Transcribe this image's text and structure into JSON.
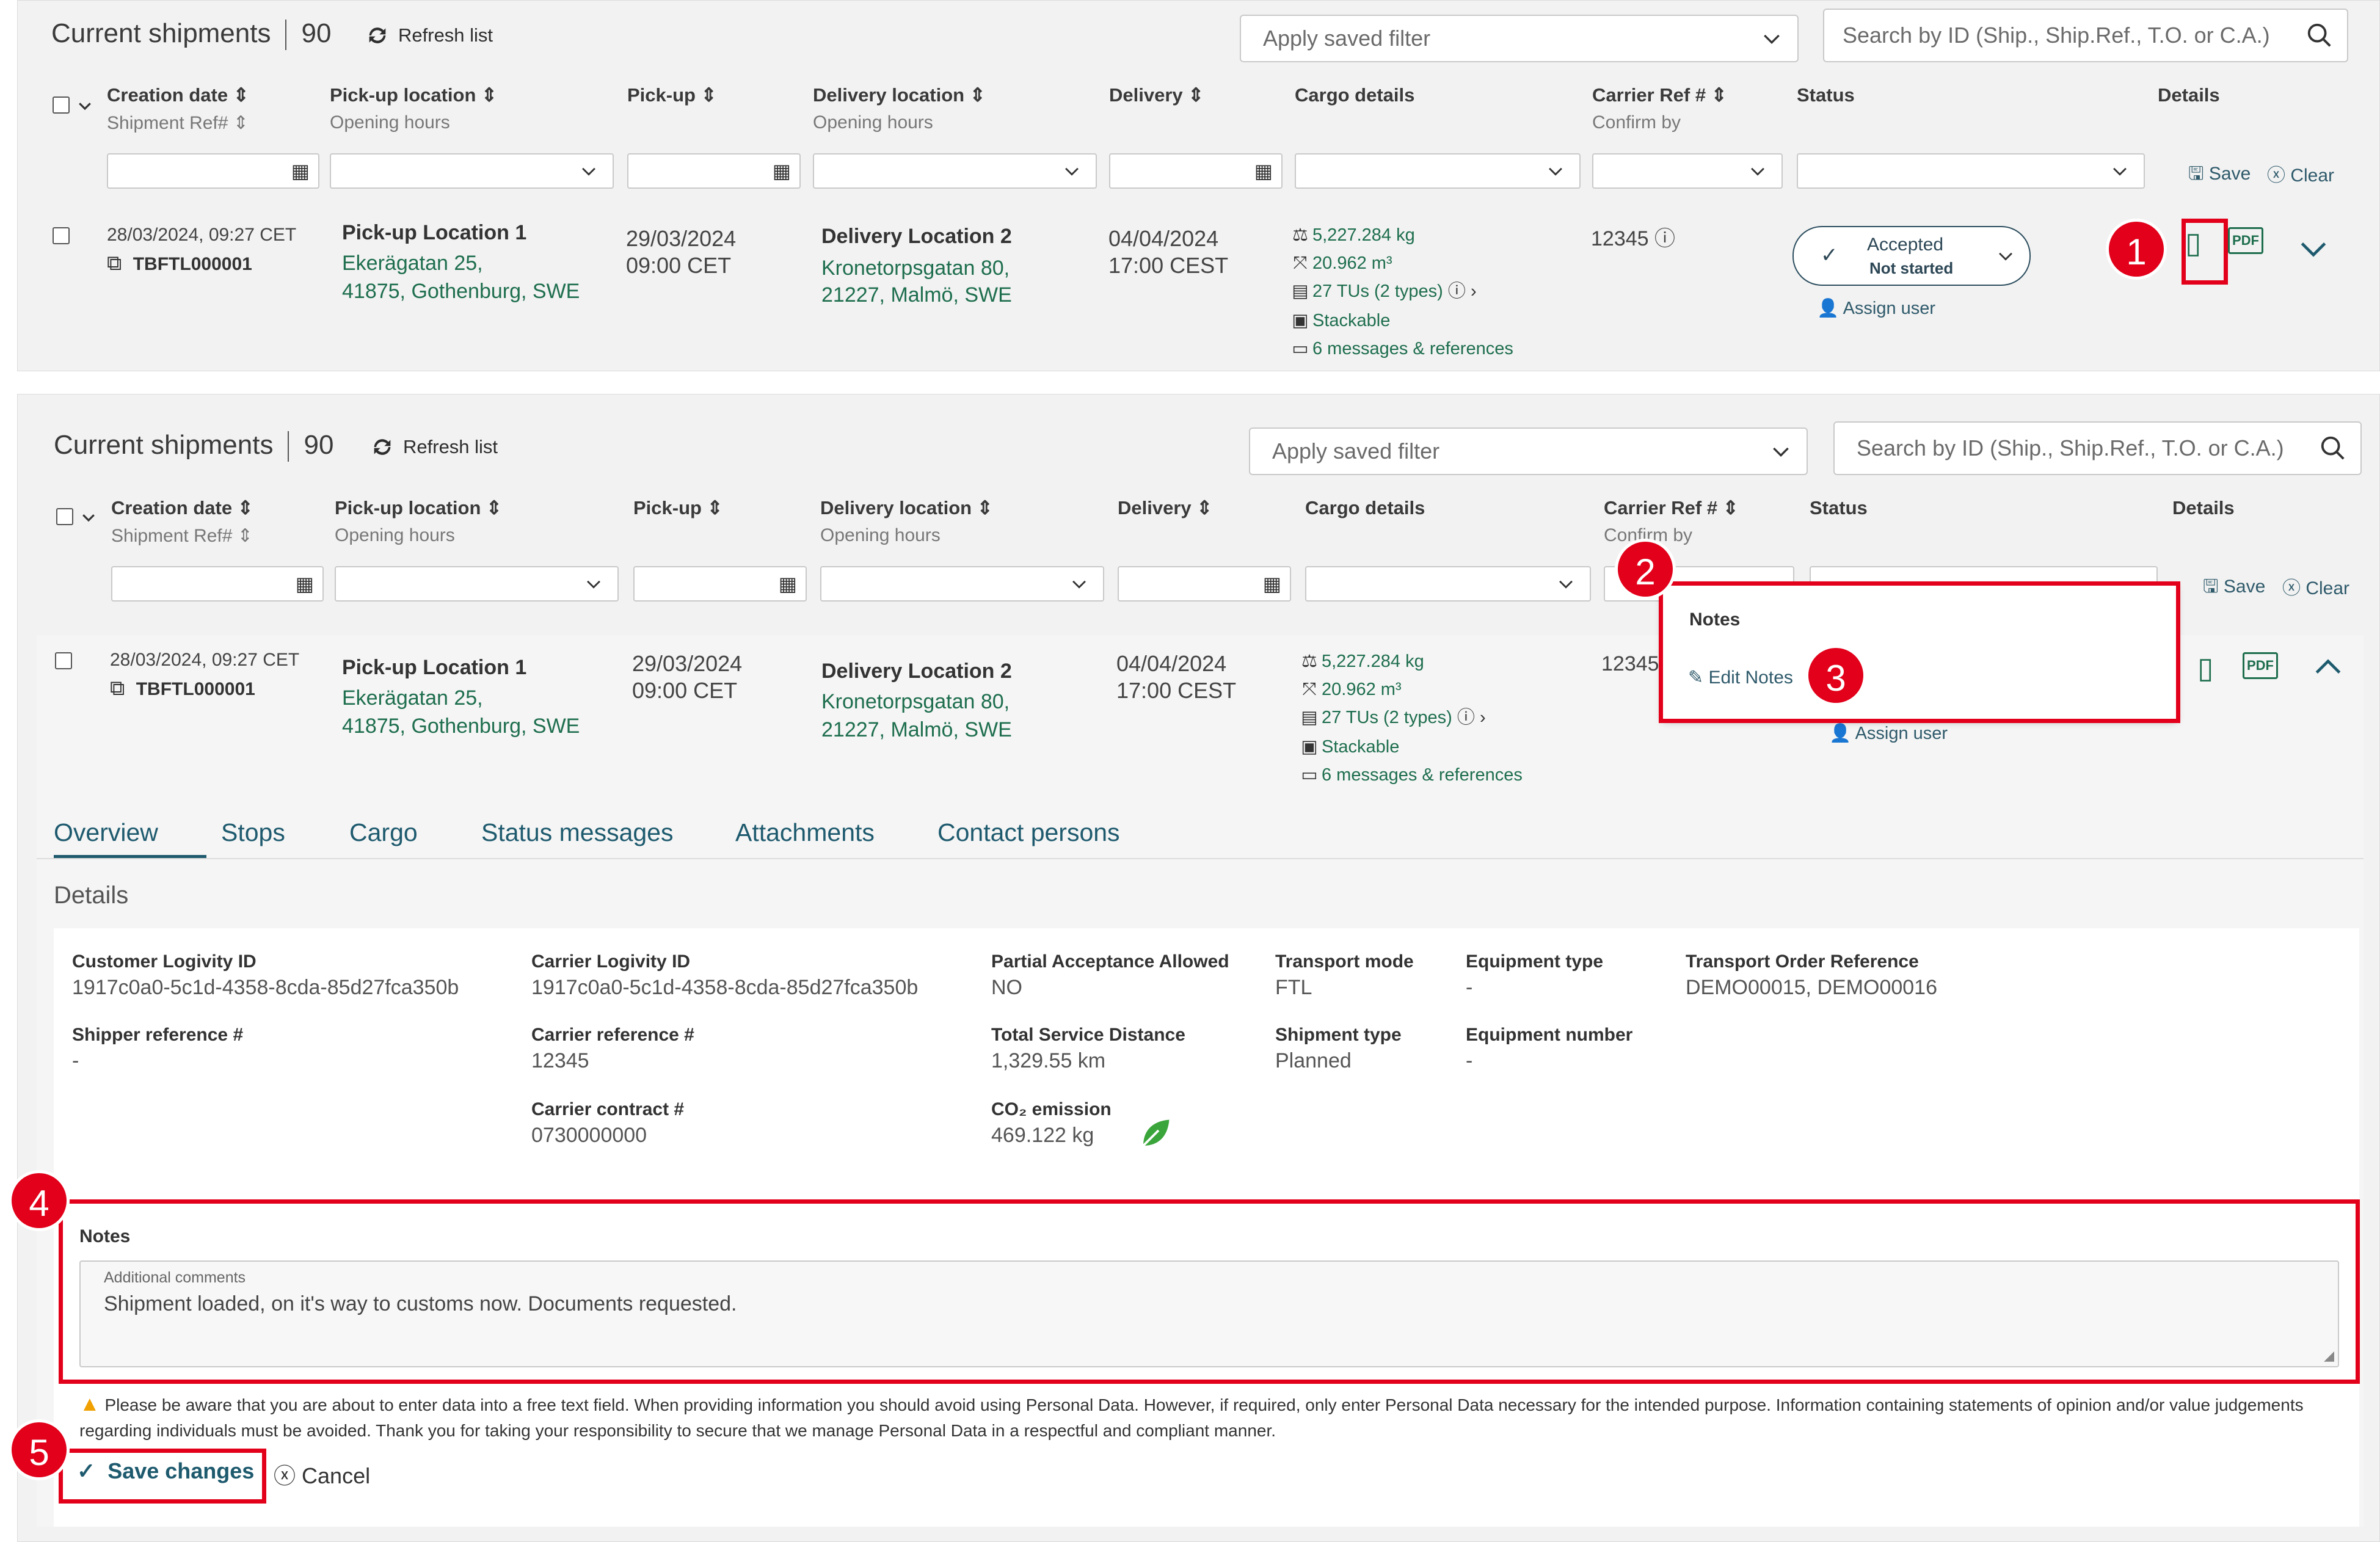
{
  "title": "Current shipments",
  "count": "90",
  "refresh_label": "Refresh list",
  "saved_filter_placeholder": "Apply saved filter",
  "search_placeholder": "Search by ID (Ship., Ship.Ref., T.O. or C.A.)",
  "columns": {
    "creation_date": "Creation date",
    "shipment_ref": "Shipment Ref#",
    "pickup_location": "Pick-up location",
    "opening_hours": "Opening hours",
    "pickup": "Pick-up",
    "delivery_location": "Delivery location",
    "delivery_opening_hours": "Opening hours",
    "delivery": "Delivery",
    "cargo_details": "Cargo details",
    "carrier_ref": "Carrier Ref #",
    "confirm_by": "Confirm by",
    "status": "Status",
    "details": "Details"
  },
  "filter_actions": {
    "save": "Save",
    "clear": "Clear"
  },
  "row": {
    "created": "28/03/2024, 09:27 CET",
    "shipment_id": "TBFTL000001",
    "pickup_name": "Pick-up Location 1",
    "pickup_addr1": "Ekerägatan 25,",
    "pickup_addr2": "41875, Gothenburg, SWE",
    "pickup_date": "29/03/2024",
    "pickup_time": "09:00 CET",
    "delivery_name": "Delivery Location 2",
    "delivery_addr1": "Kronetorpsgatan 80,",
    "delivery_addr2": "21227, Malmö, SWE",
    "delivery_date": "04/04/2024",
    "delivery_time": "17:00 CEST",
    "weight": "5,227.284 kg",
    "volume": "20.962 m³",
    "tus": "27 TUs (2 types)",
    "stackable": "Stackable",
    "messages": "6 messages & references",
    "carrier_ref": "12345",
    "status_main": "Accepted",
    "status_sub": "Not started",
    "assign_user": "Assign user"
  },
  "notes_popup": {
    "title": "Notes",
    "edit": "Edit Notes"
  },
  "tabs": [
    "Overview",
    "Stops",
    "Cargo",
    "Status messages",
    "Attachments",
    "Contact persons"
  ],
  "details_heading": "Details",
  "details": {
    "customer_id_label": "Customer Logivity ID",
    "customer_id": "1917c0a0-5c1d-4358-8cda-85d27fca350b",
    "carrier_id_label": "Carrier Logivity ID",
    "carrier_id": "1917c0a0-5c1d-4358-8cda-85d27fca350b",
    "partial_label": "Partial Acceptance Allowed",
    "partial": "NO",
    "transport_mode_label": "Transport mode",
    "transport_mode": "FTL",
    "equipment_type_label": "Equipment type",
    "equipment_type": "-",
    "to_ref_label": "Transport Order Reference",
    "to_ref": "DEMO00015, DEMO00016",
    "shipper_ref_label": "Shipper reference #",
    "shipper_ref": "-",
    "carrier_ref_label": "Carrier reference #",
    "carrier_ref": "12345",
    "distance_label": "Total Service Distance",
    "distance": "1,329.55 km",
    "shipment_type_label": "Shipment type",
    "shipment_type": "Planned",
    "equipment_number_label": "Equipment number",
    "equipment_number": "-",
    "contract_label": "Carrier contract #",
    "contract": "0730000000",
    "co2_label": "CO₂ emission",
    "co2": "469.122 kg"
  },
  "notes": {
    "label": "Notes",
    "field_label": "Additional comments",
    "value": "Shipment loaded, on it's way to customs now. Documents requested."
  },
  "warning": "Please be aware that you are about to enter data into a free text field. When providing information you should avoid using Personal Data. However, if required, only enter Personal Data necessary for the intended purpose. Information containing statements of opinion and/or value judgements regarding individuals must be avoided. Thank you for taking your responsibility to secure that we manage Personal Data in a respectful and compliant manner.",
  "save_changes": "Save changes",
  "cancel": "Cancel",
  "steps": [
    "1",
    "2",
    "3",
    "4",
    "5"
  ],
  "colors": {
    "accent_green": "#1e6e4e",
    "highlight_red": "#e2001a",
    "teal": "#1e5a6e"
  }
}
